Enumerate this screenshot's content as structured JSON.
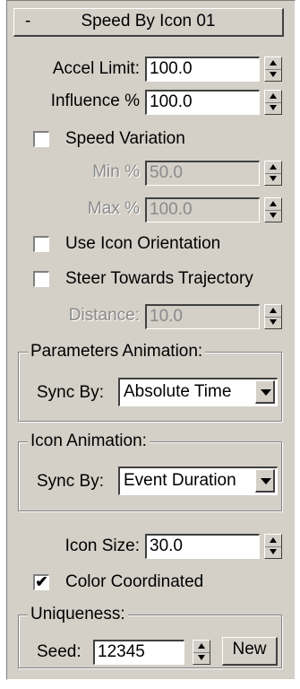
{
  "rollout": {
    "toggle": "-",
    "title": "Speed By Icon 01"
  },
  "fields": {
    "accel_limit": {
      "label": "Accel Limit:",
      "value": "100.0"
    },
    "influence": {
      "label": "Influence %",
      "value": "100.0"
    },
    "min_pct": {
      "label": "Min %",
      "value": "50.0"
    },
    "max_pct": {
      "label": "Max %",
      "value": "100.0"
    },
    "distance": {
      "label": "Distance:",
      "value": "10.0"
    },
    "icon_size": {
      "label": "Icon Size:",
      "value": "30.0"
    },
    "seed": {
      "label": "Seed:",
      "value": "12345"
    }
  },
  "checkboxes": {
    "speed_variation": {
      "label": "Speed Variation",
      "checked": false
    },
    "use_icon_orientation": {
      "label": "Use Icon Orientation",
      "checked": false
    },
    "steer_towards_trajectory": {
      "label": "Steer Towards Trajectory",
      "checked": false
    },
    "color_coordinated": {
      "label": "Color Coordinated",
      "checked": true,
      "mark": "✔"
    }
  },
  "groups": {
    "parameters_animation": {
      "legend": "Parameters Animation:",
      "sync_label": "Sync By:",
      "sync_value": "Absolute Time"
    },
    "icon_animation": {
      "legend": "Icon Animation:",
      "sync_label": "Sync By:",
      "sync_value": "Event Duration"
    },
    "uniqueness": {
      "legend": "Uniqueness:",
      "new_button": "New"
    }
  }
}
